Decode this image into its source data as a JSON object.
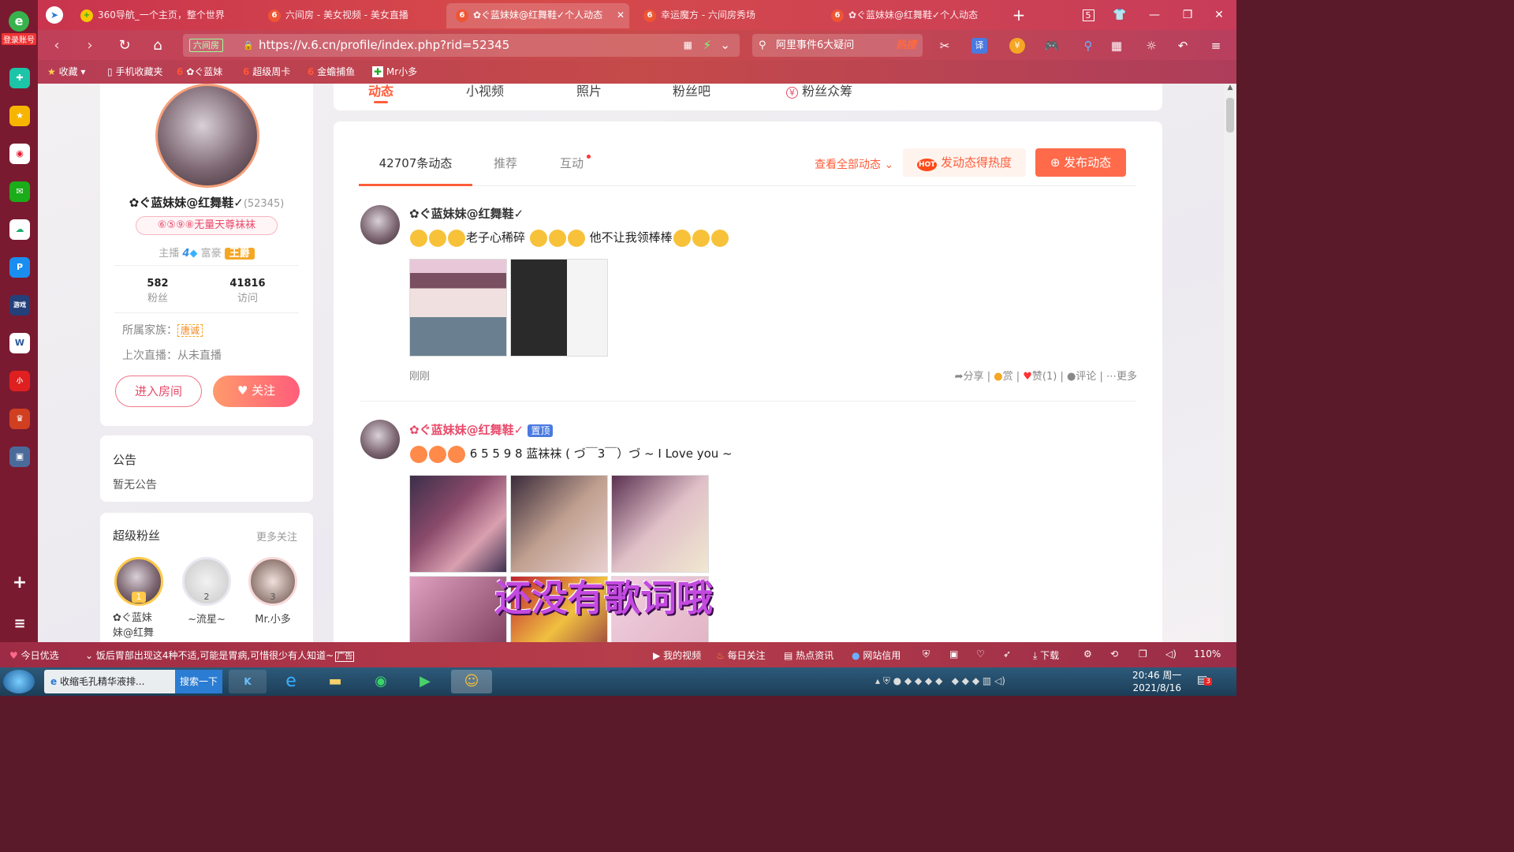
{
  "browser": {
    "login_label": "登录账号",
    "tabs": [
      {
        "label": "360导航_一个主页，整个世界"
      },
      {
        "label": "六间房 - 美女视频 - 美女直播"
      },
      {
        "label": "✿ぐ蓝妹妹@红舞鞋✓个人动态"
      },
      {
        "label": "幸运魔方 - 六间房秀场"
      },
      {
        "label": "✿ぐ蓝妹妹@红舞鞋✓个人动态"
      }
    ],
    "tab_count": "5",
    "url_tag": "六间房",
    "url": "https://v.6.cn/profile/index.php?rid=52345",
    "search_text": "阿里事件6大疑问",
    "search_hot": "热搜",
    "bookmarks": [
      "收藏",
      "手机收藏夹",
      "✿ぐ蓝妹",
      "超级周卡",
      "金蟾捕鱼",
      "Mr小多"
    ]
  },
  "profile": {
    "name": "✿ぐ蓝妹妹@红舞鞋✓",
    "rid": "(52345)",
    "title_badge": "⑥⑤⑨⑧无量天尊袜袜",
    "anchor_label": "主播",
    "anchor_level": "4",
    "rich_label": "富豪",
    "rich_badge": "王爵",
    "fans_count": "582",
    "fans_label": "粉丝",
    "visits_count": "41816",
    "visits_label": "访问",
    "family_label": "所属家族：",
    "family_value": "唐诚",
    "last_live_label": "上次直播：从未直播",
    "enter_room": "进入房间",
    "follow": "关注"
  },
  "notice": {
    "title": "公告",
    "content": "暂无公告"
  },
  "superfans": {
    "title": "超级粉丝",
    "more": "更多关注",
    "fans": [
      {
        "rank": "1",
        "name": "✿ぐ蓝妹\n妹@红舞"
      },
      {
        "rank": "2",
        "name": "~流星~"
      },
      {
        "rank": "3",
        "name": "Mr.小多"
      }
    ]
  },
  "top_tabs": [
    "动态",
    "小视频",
    "照片",
    "粉丝吧",
    "粉丝众筹"
  ],
  "feed": {
    "tabs": [
      "42707条动态",
      "推荐",
      "互动"
    ],
    "view_all": "查看全部动态",
    "heat_button": "发动态得热度",
    "publish_button": "发布动态",
    "posts": [
      {
        "author": "✿ぐ蓝妹妹@红舞鞋✓",
        "text_a": "老子心稀碎",
        "text_b": "他不让我领棒棒",
        "time": "刚刚",
        "share": "分享",
        "reward": "赏",
        "like": "赞(1)",
        "comment": "评论",
        "more": "更多"
      },
      {
        "author": "✿ぐ蓝妹妹@红舞鞋✓",
        "pinned": "置顶",
        "text": "6 5 5 9 8 蓝袜袜 ( づ￣3￣）づ ~ I Love you ~"
      }
    ]
  },
  "lyrics_overlay": "还没有歌词哦",
  "statusbar": {
    "left": "今日优选",
    "news": "饭后胃部出现这4种不适,可能是胃病,可惜很少有人知道~",
    "news_tag": "广告",
    "items": [
      "我的视频",
      "每日关注",
      "热点资讯",
      "网站信用",
      "下载"
    ],
    "zoom": "110%"
  },
  "taskbar": {
    "app1": "收缩毛孔精华液排...",
    "app1_btn": "搜索一下",
    "time": "20:46 周一",
    "date": "2021/8/16",
    "badge": "3"
  },
  "colors": {
    "accent": "#ff5d3b",
    "brand": "#e94a5f"
  }
}
